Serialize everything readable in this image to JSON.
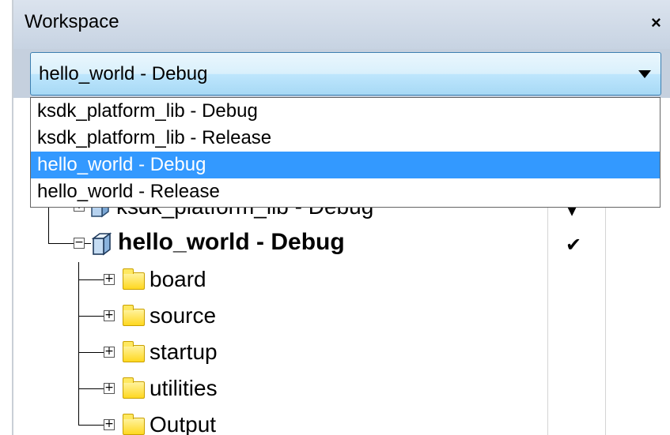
{
  "panel": {
    "title": "Workspace",
    "close_label": "×"
  },
  "configuration": {
    "selected": "hello_world - Debug",
    "options": [
      "ksdk_platform_lib - Debug",
      "ksdk_platform_lib - Release",
      "hello_world - Debug",
      "hello_world - Release"
    ],
    "highlighted_index": 2
  },
  "tree": {
    "partial_project": {
      "label": "ksdk_platform_lib - Debug",
      "check": "▾"
    },
    "project": {
      "label": "hello_world - Debug",
      "check": "✔"
    },
    "folders": [
      "board",
      "source",
      "startup",
      "utilities",
      "Output"
    ]
  },
  "colors": {
    "selection": "#3399ff",
    "titlebar": "#c7d3e2",
    "folder": "#ffd820"
  }
}
